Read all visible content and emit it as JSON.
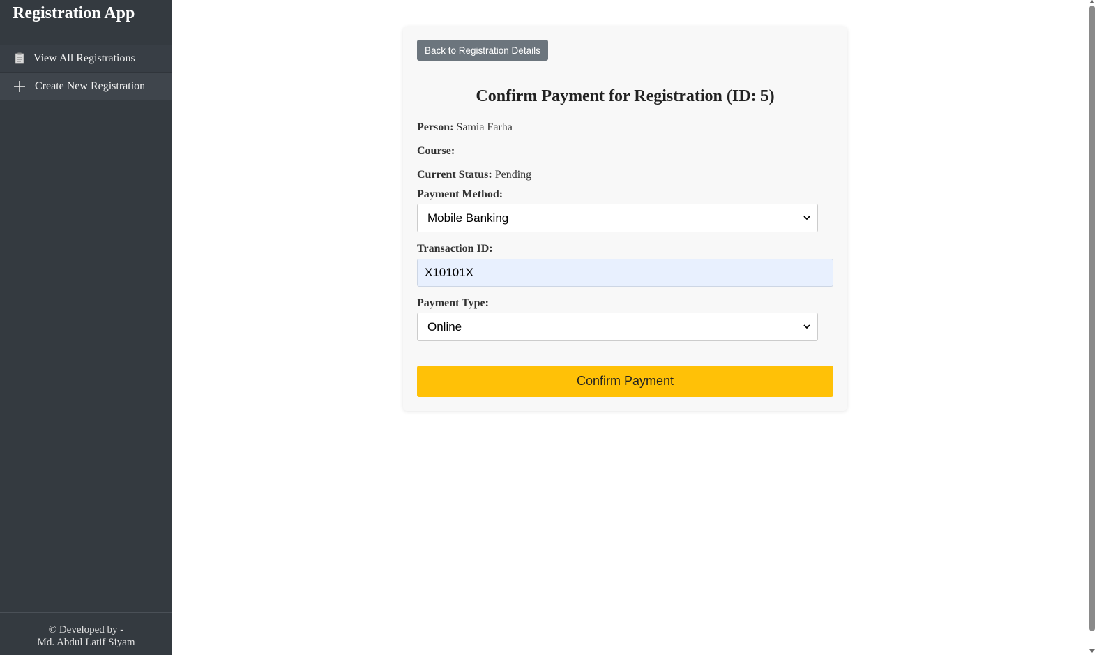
{
  "sidebar": {
    "title": "Registration App",
    "items": [
      {
        "label": "View All Registrations",
        "icon": "clipboard-icon"
      },
      {
        "label": "Create New Registration",
        "icon": "plus-icon"
      }
    ],
    "footer_line1": "© Developed by -",
    "footer_line2": "Md. Abdul Latif Siyam"
  },
  "main": {
    "back_button": "Back to Registration Details",
    "title": "Confirm Payment for Registration (ID: 5)",
    "person_label": "Person:",
    "person_value": "Samia Farha",
    "course_label": "Course:",
    "course_value": "",
    "status_label": "Current Status:",
    "status_value": "Pending",
    "payment_method_label": "Payment Method:",
    "payment_method_value": "Mobile Banking",
    "transaction_id_label": "Transaction ID:",
    "transaction_id_value": "X10101X",
    "payment_type_label": "Payment Type:",
    "payment_type_value": "Online",
    "confirm_button": "Confirm Payment"
  },
  "colors": {
    "sidebar_bg": "#343a40",
    "back_button_bg": "#6c757d",
    "confirm_button_bg": "#ffc107",
    "input_autofill_bg": "#e8f0fe"
  }
}
